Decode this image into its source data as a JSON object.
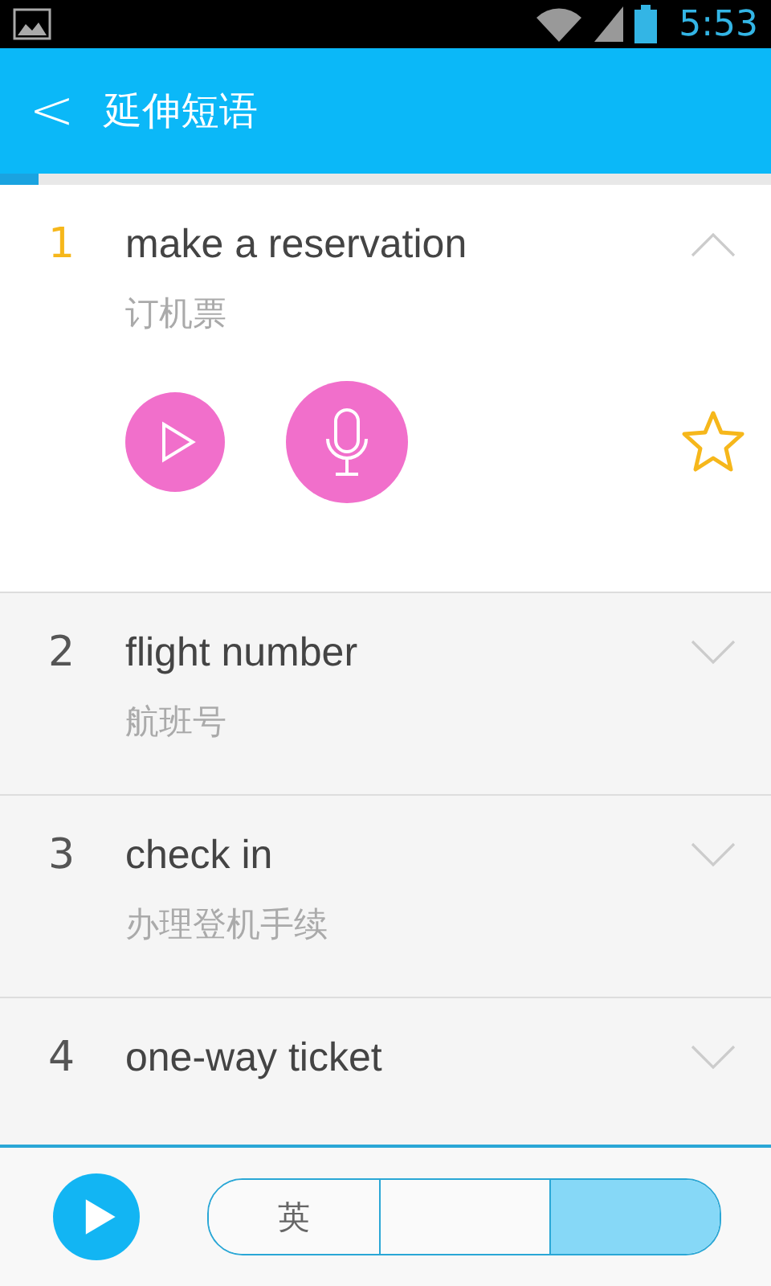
{
  "status_bar": {
    "time": "5:53"
  },
  "header": {
    "back": "<",
    "title": "延伸短语"
  },
  "progress": {
    "level": 0.05
  },
  "phrases": [
    {
      "number": "1",
      "text": "make a reservation",
      "translation": "订机票",
      "expanded": true,
      "starred": false
    },
    {
      "number": "2",
      "text": "flight number",
      "translation": "航班号",
      "expanded": false
    },
    {
      "number": "3",
      "text": "check in",
      "translation": "办理登机手续",
      "expanded": false
    },
    {
      "number": "4",
      "text": "one-way ticket",
      "expanded": false
    }
  ],
  "bottom_bar": {
    "segments": [
      {
        "label": "英",
        "selected": false
      },
      {
        "selected": false
      },
      {
        "selected": true
      }
    ]
  }
}
